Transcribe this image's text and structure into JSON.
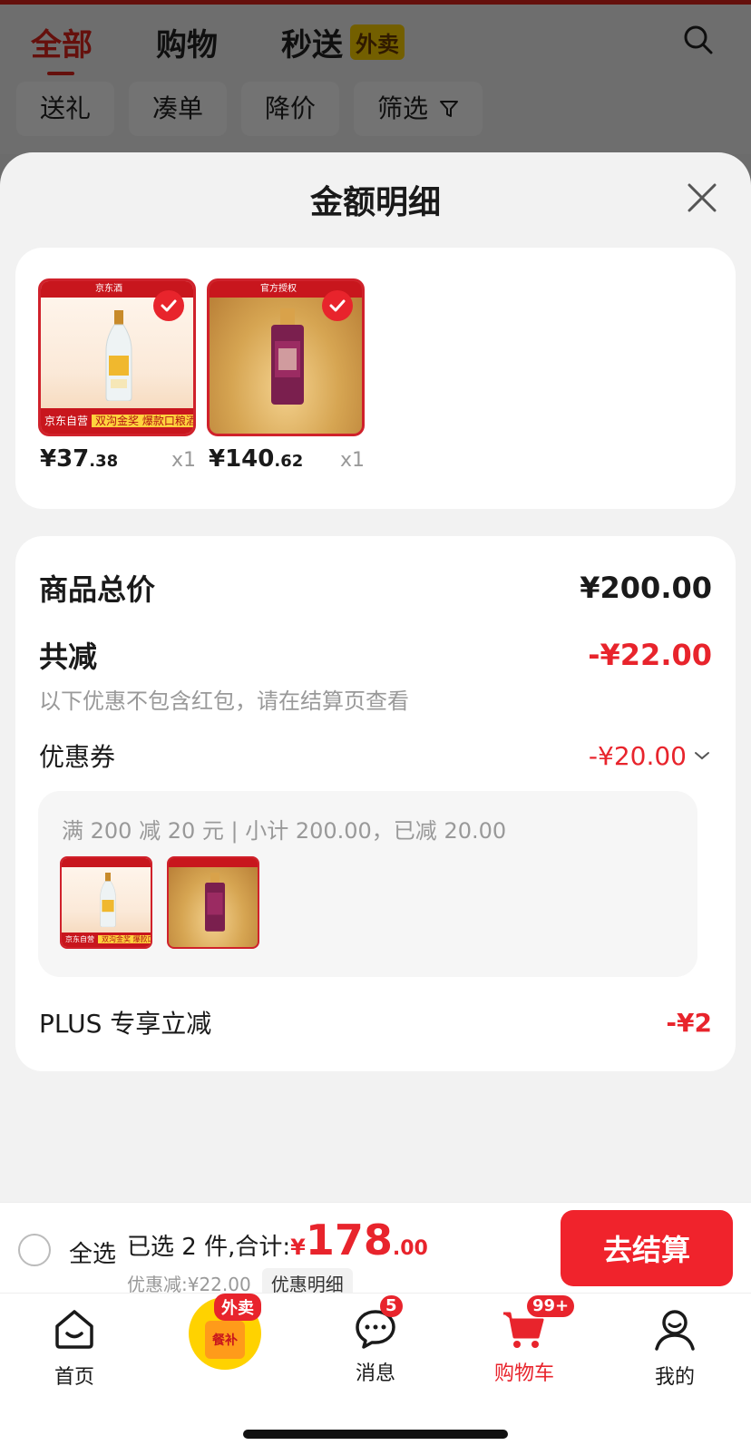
{
  "background": {
    "tabs": [
      {
        "label": "全部",
        "active": true
      },
      {
        "label": "购物",
        "active": false
      },
      {
        "label": "秒送",
        "active": false,
        "badge": "外卖"
      }
    ],
    "chips": [
      "送礼",
      "凑单",
      "降价",
      "筛选"
    ],
    "search_icon": "search-icon"
  },
  "sheet": {
    "title": "金额明细",
    "products": [
      {
        "price_int": "¥37",
        "price_dec": ".38",
        "qty": "x1",
        "img_top": "京东酒",
        "img_bottom_a": "京东自营",
        "img_bottom_b": "双沟金奖 爆款口粮酒"
      },
      {
        "price_int": "¥140",
        "price_dec": ".62",
        "qty": "x1",
        "img_top": "官方授权"
      }
    ],
    "total_label": "商品总价",
    "total_value": "¥200.00",
    "reduce_label": "共减",
    "reduce_value": "-¥22.00",
    "reduce_note": "以下优惠不包含红包，请在结算页查看",
    "coupon_label": "优惠券",
    "coupon_value": "-¥20.00",
    "coupon_detail": "满 200 减 20 元 | 小计 200.00，已减 20.00",
    "plus_label": "PLUS 专享立减",
    "plus_value": "-¥2"
  },
  "checkout": {
    "select_all": "全选",
    "summary_prefix": "已选 2 件,合计:",
    "yen": "¥",
    "amount_int": "178",
    "amount_dec": ".00",
    "discount": "优惠减:¥22.00",
    "detail_button": "优惠明细",
    "pay_button": "去结算"
  },
  "nav": {
    "home": "首页",
    "meal_tag": "外卖",
    "meal_bag": "餐补",
    "messages": "消息",
    "messages_badge": "5",
    "cart": "购物车",
    "cart_badge": "99+",
    "me": "我的"
  },
  "colors": {
    "accent": "#e8242c",
    "brand_red": "#e1251b"
  }
}
